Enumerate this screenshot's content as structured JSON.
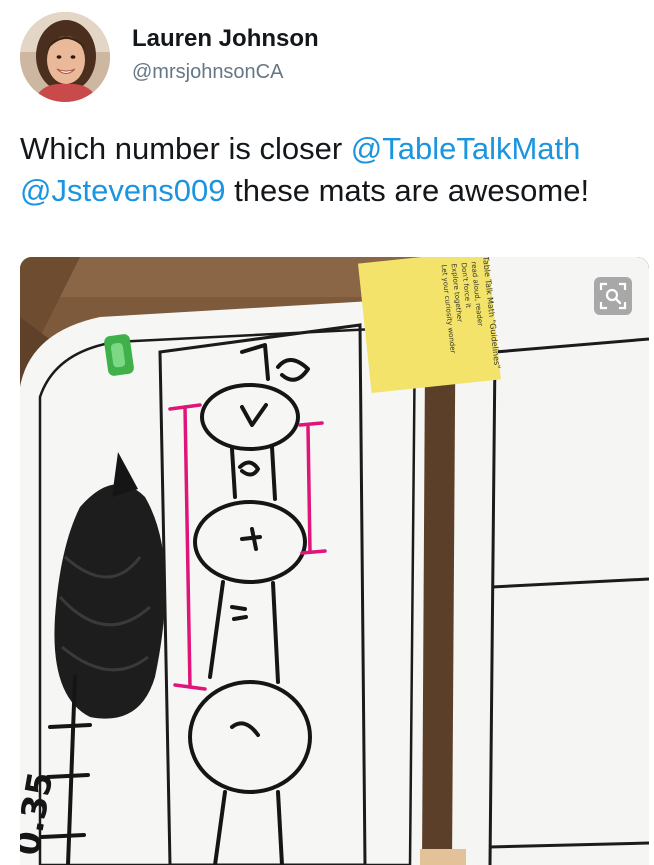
{
  "tweet": {
    "author": {
      "display_name": "Lauren Johnson",
      "handle": "@mrsjohnsonCA"
    },
    "text": {
      "prefix": "Which number is closer ",
      "mention_1": "@TableTalkMath",
      "separator": " ",
      "mention_2": "@Jstevens009",
      "suffix": " these mats are awesome!"
    },
    "media": {
      "sticky_note_lines": [
        "Table Talk Math \"Guidelines\"",
        "read aloud, reader",
        "Don't force it",
        "Explore together",
        "Let your curiosity wonder"
      ],
      "handwritten_number": "0.35"
    }
  },
  "colors": {
    "link": "#1b95e0",
    "text": "#14171a",
    "secondary": "#657786"
  },
  "icons": {
    "zoom": "magnify-icon"
  }
}
